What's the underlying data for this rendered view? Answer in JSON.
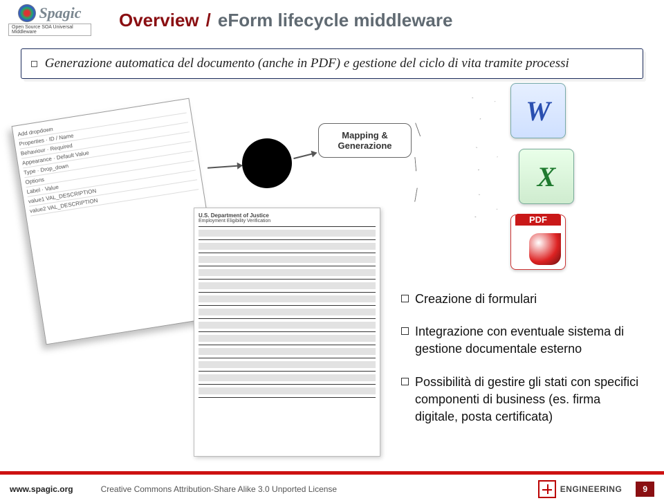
{
  "header": {
    "logo_text": "Spagic",
    "logo_sub": "Open Source SOA Universal Middleware",
    "title_main": "Overview",
    "title_sep": "/",
    "title_sub": "eForm lifecycle middleware"
  },
  "callout": {
    "text": "Generazione automatica del documento (anche in PDF) e gestione del ciclo di vita tramite processi"
  },
  "mapgen": {
    "line1": "Mapping &",
    "line2": "Generazione"
  },
  "outputs": {
    "pdf_label": "PDF"
  },
  "bullets": {
    "items": [
      "Creazione di formulari",
      "Integrazione con eventuale sistema di gestione documentale esterno",
      "Possibilità di gestire gli stati con specifici componenti di business (es. firma digitale, posta certificata)"
    ]
  },
  "form_editor_rows": [
    "Add dropdown",
    "Properties  ·  ID / Name",
    "Behaviour  ·  Required",
    "Appearance  ·  Default Value",
    "Type  ·  Drop_down",
    "Options",
    "Label  ·  Value",
    "value1  VAL_DESCRIPTION",
    "value2  VAL_DESCRIPTION"
  ],
  "gov_form": {
    "title": "U.S. Department of Justice",
    "subtitle": "Employment Eligibility Verification"
  },
  "footer": {
    "url": "www.spagic.org",
    "cc": "Creative Commons Attribution-Share Alike 3.0 Unported License",
    "eng": "ENGINEERING",
    "page": "9"
  }
}
